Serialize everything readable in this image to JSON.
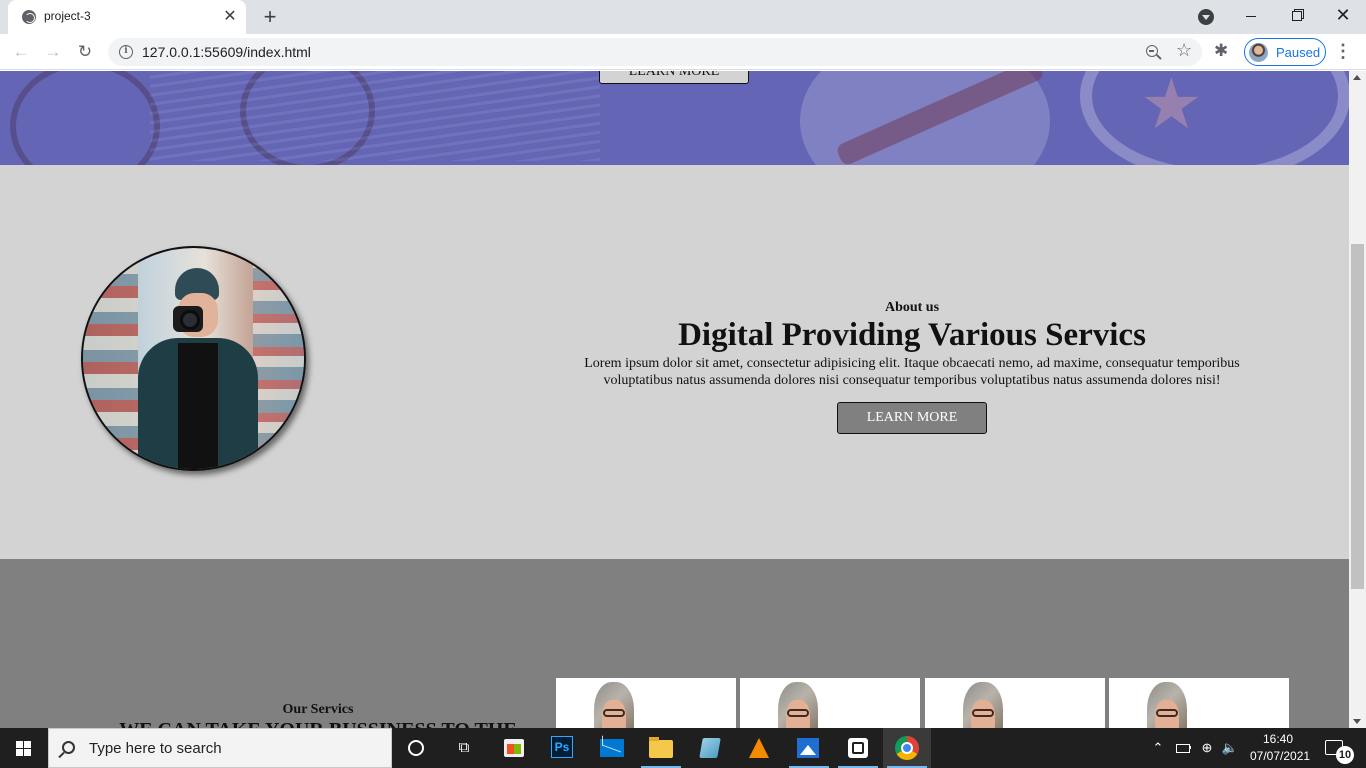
{
  "browser": {
    "tab_title": "project-3",
    "tab_close_glyph": "✕",
    "new_tab_glyph": "+",
    "url": "127.0.0.1:55609/index.html",
    "profile_label": "Paused",
    "back_glyph": "←",
    "forward_glyph": "→",
    "reload_glyph": "↻",
    "star_glyph": "☆",
    "extensions_glyph": "✱",
    "menu_glyph": "⋮",
    "info_glyph": "i",
    "close_glyph": "✕",
    "icons": [
      "globe-favicon-icon",
      "tab-search-icon",
      "back-arrow-icon",
      "forward-arrow-icon",
      "reload-icon",
      "info-icon",
      "zoom-icon",
      "star-icon",
      "puzzle-extension-icon",
      "profile-avatar-icon",
      "kebab-menu-icon"
    ]
  },
  "page": {
    "hero_button": "LEARN MORE",
    "about": {
      "subtitle": "About us",
      "title": "Digital Providing Various Servics",
      "body": "Lorem ipsum dolor sit amet, consectetur adipisicing elit. Itaque obcaecati nemo, ad maxime, consequatur temporibus voluptatibus natus assumenda dolores nisi consequatur temporibus voluptatibus natus assumenda dolores nisi!",
      "button": "LEARN MORE"
    },
    "services": {
      "subtitle": "Our Servics",
      "title": "WE CAN TAKE YOUR BUSSINESS TO THE",
      "card_count": 4
    }
  },
  "taskbar": {
    "search_placeholder": "Type here to search",
    "ps_label": "Ps",
    "taskview_glyph": "⧉",
    "chevron_glyph": "⌃",
    "net_glyph": "⊕",
    "vol_glyph": "🔈",
    "time": "16:40",
    "date": "07/07/2021",
    "notifications": "10",
    "apps": [
      "cortana-icon",
      "task-view-icon",
      "store-icon",
      "photoshop-icon",
      "mail-icon",
      "file-explorer-icon",
      "notes-icon",
      "vlc-icon",
      "photos-icon",
      "app-box-icon",
      "chrome-icon"
    ]
  },
  "colors": {
    "hero": "#6466b5",
    "about_bg": "#d3d3d3",
    "services_bg": "#808080",
    "button_gray": "#808080",
    "profile_accent": "#1a73e8",
    "taskbar": "#1f1f1f"
  },
  "scroll_position": 0.27
}
